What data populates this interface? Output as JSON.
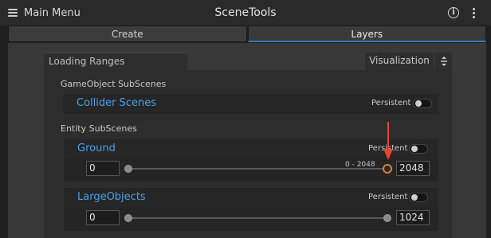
{
  "window": {
    "menu_label": "Main Menu",
    "title": "SceneTools",
    "info_icon": "info-icon",
    "more_icon": "kebab-menu-icon"
  },
  "tabs": [
    {
      "label": "Create",
      "active": false
    },
    {
      "label": "Layers",
      "active": true
    }
  ],
  "section": {
    "title": "Loading Ranges",
    "visualization_label": "Visualization"
  },
  "groups": {
    "gameobject": {
      "label": "GameObject SubScenes",
      "scenes": [
        {
          "name": "Collider Scenes",
          "persistent_label": "Persistent",
          "persistent": false
        }
      ]
    },
    "entity": {
      "label": "Entity SubScenes",
      "scenes": [
        {
          "name": "Ground",
          "persistent_label": "Persistent",
          "persistent": false,
          "min": "0",
          "max": "2048",
          "range_label": "0 - 2048",
          "handle_highlighted": true
        },
        {
          "name": "LargeObjects",
          "persistent_label": "Persistent",
          "persistent": false,
          "min": "0",
          "max": "1024",
          "range_label": "",
          "handle_highlighted": false
        }
      ]
    }
  },
  "colors": {
    "accent_blue": "#4aa0ec",
    "tab_underline": "#3a79bb",
    "highlight_orange": "#e07b39",
    "annotation_arrow": "#e8452c"
  }
}
